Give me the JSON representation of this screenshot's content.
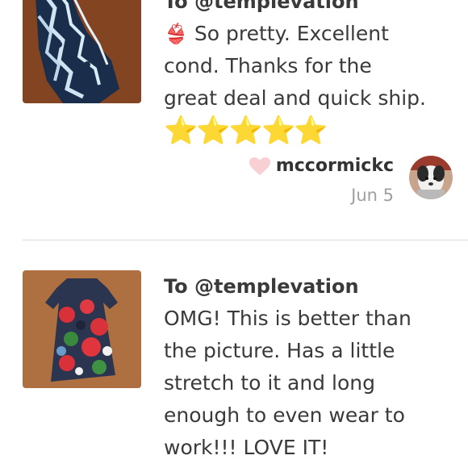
{
  "notes": [
    {
      "to": "To @templevation",
      "emoji": "👙",
      "message_line1": "So pretty. Excellent",
      "message_line2": "cond. Thanks for the",
      "message_line3": "great deal and quick ship.",
      "stars": "⭐⭐⭐⭐⭐",
      "rating_stars": 5,
      "author": "mccormickc",
      "date": "Jun 5",
      "thumbnail_icon": "swimsuit-photo",
      "avatar_icon": "dog-avatar"
    },
    {
      "to": "To @templevation",
      "message_line1": "OMG! This is better than",
      "message_line2": "the picture. Has a little",
      "message_line3": "stretch to it and long",
      "message_line4": "enough to even wear to",
      "message_line5": "work!!! LOVE IT!",
      "thumbnail_icon": "floral-dress-photo"
    }
  ],
  "colors": {
    "text": "#3a3a3a",
    "muted": "#a0a0a0",
    "heart": "#f8cfd3",
    "divider": "#d9d9d9",
    "star": "#f5c400"
  }
}
